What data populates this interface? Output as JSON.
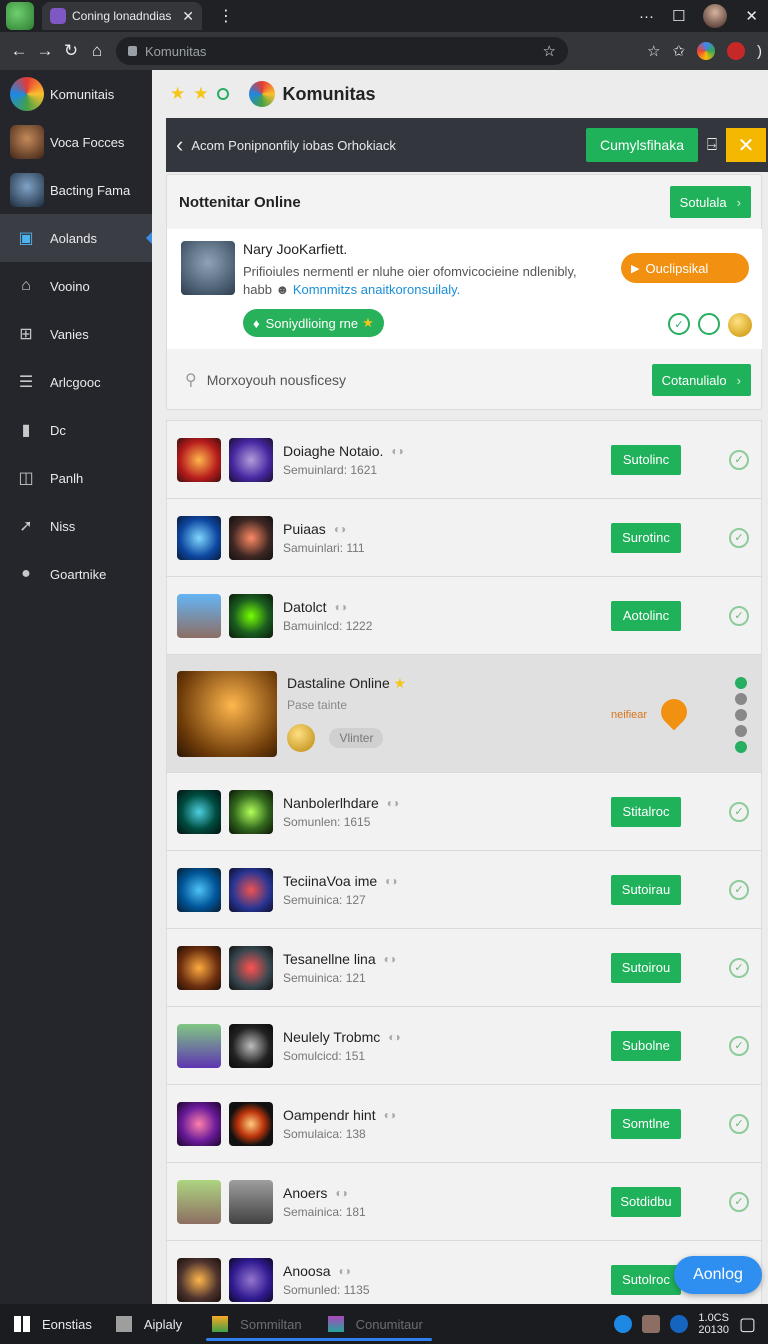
{
  "browser": {
    "tab_title": "Coning lonadndias",
    "address": "Komunitas"
  },
  "sidebar": {
    "items": [
      {
        "label": "Komunitais"
      },
      {
        "label": "Voca Focces"
      },
      {
        "label": "Bacting Fama"
      },
      {
        "label": "Aolands"
      },
      {
        "label": "Vooino"
      },
      {
        "label": "Vanies"
      },
      {
        "label": "Arlcgooc"
      },
      {
        "label": "Dc"
      },
      {
        "label": "Panlh"
      },
      {
        "label": "Niss"
      },
      {
        "label": "Goartnike"
      }
    ]
  },
  "header": {
    "title": "Komunitas"
  },
  "banner": {
    "message": "Acom Ponipnonfily iobas Orhokiack",
    "primary_button": "Cumylsfihaka"
  },
  "panel": {
    "title": "Nottenitar Online",
    "header_button": "Sotulala",
    "news": {
      "title": "Nary JooKarfiett.",
      "body_1": "Prifioiules nermentl er nluhe oier ofomvicocieine ndlenibly,",
      "body_2": "habb",
      "body_link": "Komnmitzs anaitkoronsuilaly.",
      "cta": "Ouclipsikal",
      "pill_button": "Soniydlioing rne"
    },
    "search_placeholder": "Morxoyouh nousficesy",
    "search_button": "Cotanulialo"
  },
  "games": [
    {
      "title": "Doiaghe Notaio.",
      "sub": "Semuinlard: 1621",
      "button": "Sutolinc"
    },
    {
      "title": "Puiaas",
      "sub": "Samuinlari: 111",
      "button": "Surotinc"
    },
    {
      "title": "Datolct",
      "sub": "Bamuinlcd: 1222",
      "button": "Aotolinc"
    },
    {
      "title": "Dastaline Online",
      "sub": "Pase taintе",
      "chip": "Vlinter",
      "side_label": "neifiear"
    },
    {
      "title": "Nanbolerlhdare",
      "sub": "Somunlen: 1615",
      "button": "Stitalroc"
    },
    {
      "title": "TeciinaVoa ime",
      "sub": "Semuinica: 127",
      "button": "Sutoirau"
    },
    {
      "title": "Tesanellne lina",
      "sub": "Semuinica: 121",
      "button": "Sutoirou"
    },
    {
      "title": "Neulely Trobmc",
      "sub": "Somulcicd: 151",
      "button": "Subolne"
    },
    {
      "title": "Oampendr hint",
      "sub": "Somulaica: 138",
      "button": "Somtlne"
    },
    {
      "title": "Anoers",
      "sub": "Semainica: 181",
      "button": "Sotdidbu"
    },
    {
      "title": "Anoosa",
      "sub": "Somunled: 1135",
      "button": "Sutolroc"
    }
  ],
  "floating_button": "Aonlog",
  "taskbar": {
    "start_label": "Eonstias",
    "app_label": "Aiplaly",
    "item_1": "Sommiltan",
    "item_2": "Conumitaur",
    "time": "1.0CS",
    "date": "20130"
  },
  "colors": {
    "accent_green": "#1fb25a",
    "accent_orange": "#f29011",
    "accent_yellow": "#f5b800",
    "accent_blue": "#2f8ff0",
    "sidebar_bg": "#25262b"
  }
}
